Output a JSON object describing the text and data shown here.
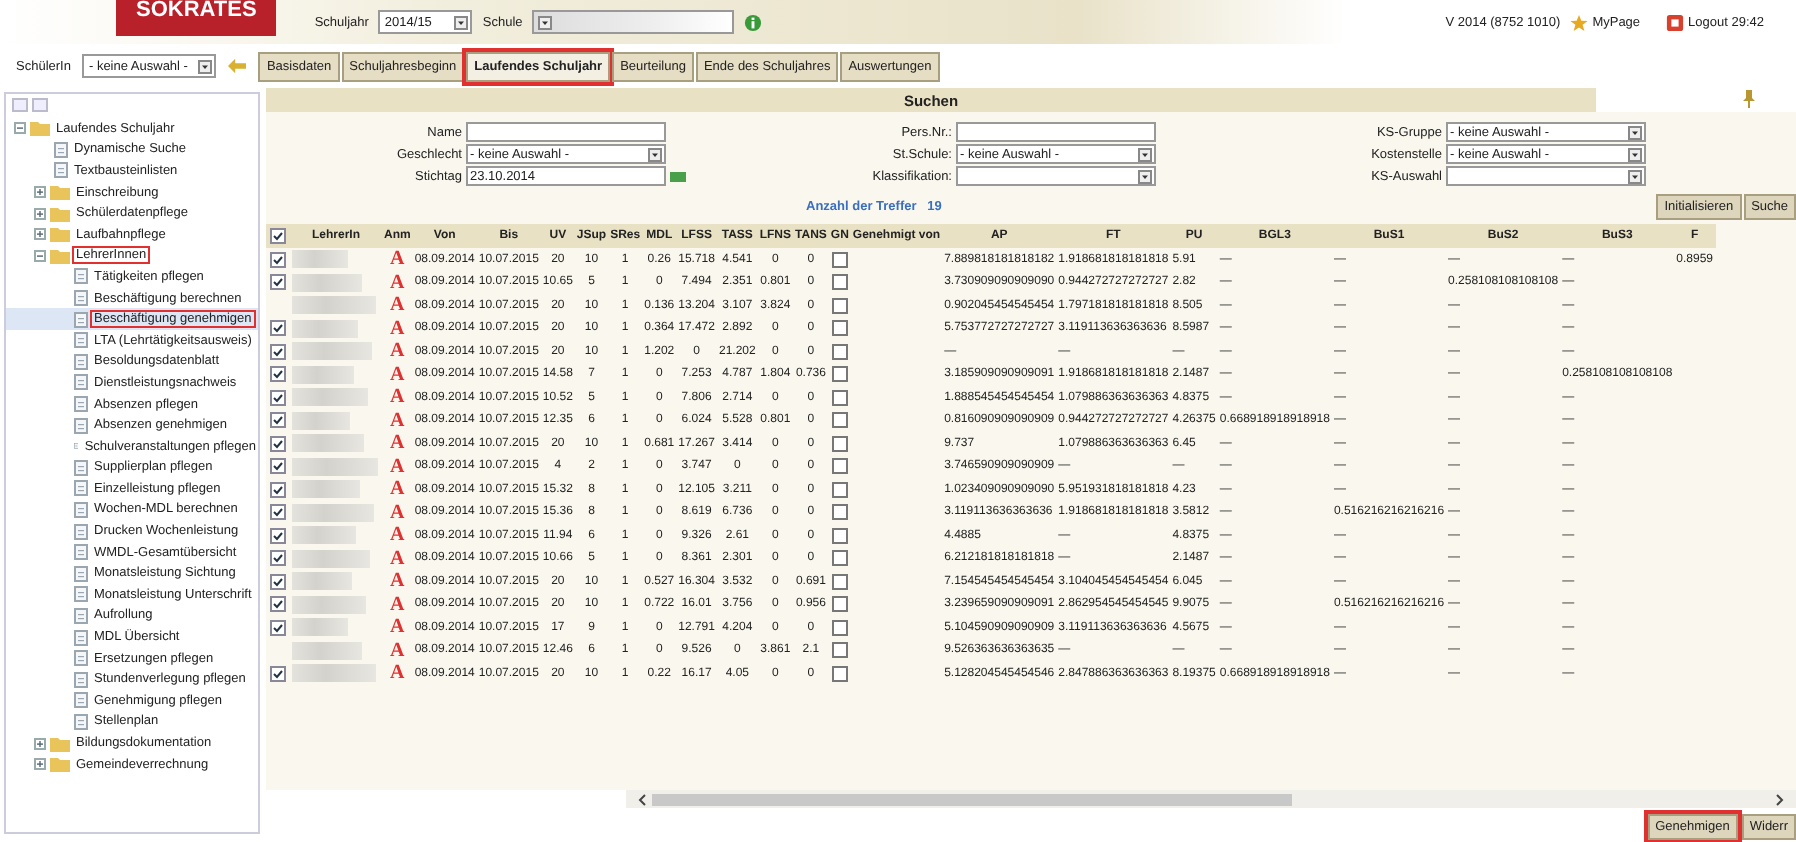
{
  "header": {
    "logo": "SOKRATES",
    "schuljahr_label": "Schuljahr",
    "schuljahr": "2014/15",
    "schule_label": "Schule",
    "version": "V 2014 (8752 1010)",
    "mypage": "MyPage",
    "logout": "Logout 29:42"
  },
  "student_filter": {
    "label": "SchülerIn",
    "value": "- keine Auswahl -"
  },
  "tabs": [
    {
      "label": "Basisdaten",
      "selected": false,
      "marked": false
    },
    {
      "label": "Schuljahresbeginn",
      "selected": false,
      "marked": false
    },
    {
      "label": "Laufendes Schuljahr",
      "selected": true,
      "marked": true
    },
    {
      "label": "Beurteilung",
      "selected": false,
      "marked": false
    },
    {
      "label": "Ende des Schuljahres",
      "selected": false,
      "marked": false
    },
    {
      "label": "Auswertungen",
      "selected": false,
      "marked": false
    }
  ],
  "sidebar": {
    "tree": [
      {
        "label": "Laufendes Schuljahr",
        "kind": "folder",
        "expanded": true,
        "selected": false,
        "marked": false,
        "children": [
          {
            "label": "Dynamische Suche",
            "kind": "page",
            "selected": false,
            "marked": false
          },
          {
            "label": "Textbausteinlisten",
            "kind": "page",
            "selected": false,
            "marked": false
          },
          {
            "label": "Einschreibung",
            "kind": "folder",
            "expanded": false,
            "selected": false,
            "marked": false
          },
          {
            "label": "Schülerdatenpflege",
            "kind": "folder",
            "expanded": false,
            "selected": false,
            "marked": false
          },
          {
            "label": "Laufbahnpflege",
            "kind": "folder",
            "expanded": false,
            "selected": false,
            "marked": false
          },
          {
            "label": "LehrerInnen",
            "kind": "folder",
            "expanded": true,
            "selected": false,
            "marked": true,
            "children": [
              {
                "label": "Tätigkeiten pflegen",
                "kind": "page",
                "selected": false,
                "marked": false
              },
              {
                "label": "Beschäftigung berechnen",
                "kind": "page",
                "selected": false,
                "marked": false
              },
              {
                "label": "Beschäftigung genehmigen",
                "kind": "page",
                "selected": true,
                "marked": true
              },
              {
                "label": "LTA (Lehrtätigkeitsausweis)",
                "kind": "page",
                "selected": false,
                "marked": false
              },
              {
                "label": "Besoldungsdatenblatt",
                "kind": "page",
                "selected": false,
                "marked": false
              },
              {
                "label": "Dienstleistungsnachweis",
                "kind": "page",
                "selected": false,
                "marked": false
              },
              {
                "label": "Absenzen pflegen",
                "kind": "page",
                "selected": false,
                "marked": false
              },
              {
                "label": "Absenzen genehmigen",
                "kind": "page",
                "selected": false,
                "marked": false
              },
              {
                "label": "Schulveranstaltungen pflegen",
                "kind": "page",
                "selected": false,
                "marked": false
              },
              {
                "label": "Supplierplan pflegen",
                "kind": "page",
                "selected": false,
                "marked": false
              },
              {
                "label": "Einzelleistung pflegen",
                "kind": "page",
                "selected": false,
                "marked": false
              },
              {
                "label": "Wochen-MDL berechnen",
                "kind": "page",
                "selected": false,
                "marked": false
              },
              {
                "label": "Drucken Wochenleistung",
                "kind": "page",
                "selected": false,
                "marked": false
              },
              {
                "label": "WMDL-Gesamtübersicht",
                "kind": "page",
                "selected": false,
                "marked": false
              },
              {
                "label": "Monatsleistung Sichtung",
                "kind": "page",
                "selected": false,
                "marked": false
              },
              {
                "label": "Monatsleistung Unterschrift",
                "kind": "page",
                "selected": false,
                "marked": false
              },
              {
                "label": "Aufrollung",
                "kind": "page",
                "selected": false,
                "marked": false
              },
              {
                "label": "MDL Übersicht",
                "kind": "page",
                "selected": false,
                "marked": false
              },
              {
                "label": "Ersetzungen pflegen",
                "kind": "page",
                "selected": false,
                "marked": false
              },
              {
                "label": "Stundenverlegung pflegen",
                "kind": "page",
                "selected": false,
                "marked": false
              },
              {
                "label": "Genehmigung pflegen",
                "kind": "page",
                "selected": false,
                "marked": false
              },
              {
                "label": "Stellenplan",
                "kind": "page",
                "selected": false,
                "marked": false
              }
            ]
          },
          {
            "label": "Bildungsdokumentation",
            "kind": "folder",
            "expanded": false,
            "selected": false,
            "marked": false
          },
          {
            "label": "Gemeindeverrechnung",
            "kind": "folder",
            "expanded": false,
            "selected": false,
            "marked": false
          }
        ]
      }
    ]
  },
  "search": {
    "title": "Suchen",
    "fields": [
      [
        {
          "label": "Name",
          "kind": "text"
        },
        {
          "label": "Geschlecht",
          "kind": "select",
          "value": "- keine Auswahl -"
        },
        {
          "label": "Stichtag",
          "kind": "date",
          "value": "23.10.2014"
        }
      ],
      [
        {
          "label": "Pers.Nr.:",
          "kind": "text"
        },
        {
          "label": "St.Schule:",
          "kind": "select",
          "value": "- keine Auswahl -"
        },
        {
          "label": "Klassifikation:",
          "kind": "select"
        }
      ],
      [
        {
          "label": "KS-Gruppe",
          "kind": "select",
          "value": "- keine Auswahl -"
        },
        {
          "label": "Kostenstelle",
          "kind": "select",
          "value": "- keine Auswahl -"
        },
        {
          "label": "KS-Auswahl",
          "kind": "select"
        }
      ]
    ],
    "hits_label": "Anzahl der Treffer",
    "hits": "19",
    "buttons": [
      "Initialisieren",
      "Suche"
    ]
  },
  "table": {
    "select_all": true,
    "columns": [
      "LehrerIn",
      "Anm",
      "Von",
      "Bis",
      "UV",
      "JSup",
      "SRes",
      "MDL",
      "LFSS",
      "TASS",
      "LFNS",
      "TANS",
      "GN",
      "Genehmigt von",
      "AP",
      "FT",
      "PU",
      "BGL3",
      "BuS1",
      "BuS2",
      "BuS3",
      "F"
    ],
    "rows": [
      {
        "has_checkbox": true,
        "checked": true,
        "anm": "A",
        "values": [
          "08.09.2014",
          "10.07.2015",
          "20",
          "10",
          "1",
          "0.26",
          "15.718",
          "4.541",
          "0",
          "0"
        ],
        "gn": false,
        "results": [
          "7.889818181818182",
          "1.918681818181818",
          "5.91",
          "—",
          "—",
          "—",
          "—",
          "0.8959"
        ]
      },
      {
        "has_checkbox": true,
        "checked": true,
        "anm": "A",
        "values": [
          "08.09.2014",
          "10.07.2015",
          "10.65",
          "5",
          "1",
          "0",
          "7.494",
          "2.351",
          "0.801",
          "0"
        ],
        "gn": false,
        "results": [
          "3.730909090909090",
          "0.944272727272727",
          "2.82",
          "—",
          "—",
          "0.258108108108108",
          "—"
        ]
      },
      {
        "has_checkbox": false,
        "checked": false,
        "anm": "A",
        "values": [
          "08.09.2014",
          "10.07.2015",
          "20",
          "10",
          "1",
          "0.136",
          "13.204",
          "3.107",
          "3.824",
          "0"
        ],
        "gn": false,
        "results": [
          "0.902045454545454",
          "1.797181818181818",
          "8.505",
          "—",
          "—",
          "—",
          "—"
        ]
      },
      {
        "has_checkbox": true,
        "checked": true,
        "anm": "A",
        "values": [
          "08.09.2014",
          "10.07.2015",
          "20",
          "10",
          "1",
          "0.364",
          "17.472",
          "2.892",
          "0",
          "0"
        ],
        "gn": false,
        "results": [
          "5.753772727272727",
          "3.119113636363636",
          "8.5987",
          "—",
          "—",
          "—",
          "—"
        ]
      },
      {
        "has_checkbox": true,
        "checked": true,
        "anm": "A",
        "values": [
          "08.09.2014",
          "10.07.2015",
          "20",
          "10",
          "1",
          "1.202",
          "0",
          "21.202",
          "0",
          "0"
        ],
        "gn": false,
        "results": [
          "—",
          "—",
          "—",
          "—",
          "—",
          "—",
          "—"
        ]
      },
      {
        "has_checkbox": true,
        "checked": true,
        "anm": "A",
        "values": [
          "08.09.2014",
          "10.07.2015",
          "14.58",
          "7",
          "1",
          "0",
          "7.253",
          "4.787",
          "1.804",
          "0.736"
        ],
        "gn": false,
        "results": [
          "3.185909090909091",
          "1.918681818181818",
          "2.1487",
          "—",
          "—",
          "—",
          "0.258108108108108"
        ]
      },
      {
        "has_checkbox": true,
        "checked": true,
        "anm": "A",
        "values": [
          "08.09.2014",
          "10.07.2015",
          "10.52",
          "5",
          "1",
          "0",
          "7.806",
          "2.714",
          "0",
          "0"
        ],
        "gn": false,
        "results": [
          "1.888545454545454",
          "1.079886363636363",
          "4.8375",
          "—",
          "—",
          "—",
          "—"
        ]
      },
      {
        "has_checkbox": true,
        "checked": true,
        "anm": "A",
        "values": [
          "08.09.2014",
          "10.07.2015",
          "12.35",
          "6",
          "1",
          "0",
          "6.024",
          "5.528",
          "0.801",
          "0"
        ],
        "gn": false,
        "results": [
          "0.816090909090909",
          "0.944272727272727",
          "4.26375",
          "0.668918918918918",
          "—",
          "—",
          "—"
        ]
      },
      {
        "has_checkbox": true,
        "checked": true,
        "anm": "A",
        "values": [
          "08.09.2014",
          "10.07.2015",
          "20",
          "10",
          "1",
          "0.681",
          "17.267",
          "3.414",
          "0",
          "0"
        ],
        "gn": false,
        "results": [
          "9.737",
          "1.079886363636363",
          "6.45",
          "—",
          "—",
          "—",
          "—"
        ]
      },
      {
        "has_checkbox": true,
        "checked": true,
        "anm": "A",
        "values": [
          "08.09.2014",
          "10.07.2015",
          "4",
          "2",
          "1",
          "0",
          "3.747",
          "0",
          "0",
          "0"
        ],
        "gn": false,
        "results": [
          "3.746590909090909",
          "—",
          "—",
          "—",
          "—",
          "—",
          "—"
        ]
      },
      {
        "has_checkbox": true,
        "checked": true,
        "anm": "A",
        "values": [
          "08.09.2014",
          "10.07.2015",
          "15.32",
          "8",
          "1",
          "0",
          "12.105",
          "3.211",
          "0",
          "0"
        ],
        "gn": false,
        "results": [
          "1.023409090909090",
          "5.951931818181818",
          "4.23",
          "—",
          "—",
          "—",
          "—"
        ]
      },
      {
        "has_checkbox": true,
        "checked": true,
        "anm": "A",
        "values": [
          "08.09.2014",
          "10.07.2015",
          "15.36",
          "8",
          "1",
          "0",
          "8.619",
          "6.736",
          "0",
          "0"
        ],
        "gn": false,
        "results": [
          "3.119113636363636",
          "1.918681818181818",
          "3.5812",
          "—",
          "0.516216216216216",
          "—",
          "—"
        ]
      },
      {
        "has_checkbox": true,
        "checked": true,
        "anm": "A",
        "values": [
          "08.09.2014",
          "10.07.2015",
          "11.94",
          "6",
          "1",
          "0",
          "9.326",
          "2.61",
          "0",
          "0"
        ],
        "gn": false,
        "results": [
          "4.4885",
          "—",
          "4.8375",
          "—",
          "—",
          "—",
          "—"
        ]
      },
      {
        "has_checkbox": true,
        "checked": true,
        "anm": "A",
        "values": [
          "08.09.2014",
          "10.07.2015",
          "10.66",
          "5",
          "1",
          "0",
          "8.361",
          "2.301",
          "0",
          "0"
        ],
        "gn": false,
        "results": [
          "6.212181818181818",
          "—",
          "2.1487",
          "—",
          "—",
          "—",
          "—"
        ]
      },
      {
        "has_checkbox": true,
        "checked": true,
        "anm": "A",
        "values": [
          "08.09.2014",
          "10.07.2015",
          "20",
          "10",
          "1",
          "0.527",
          "16.304",
          "3.532",
          "0",
          "0.691"
        ],
        "gn": false,
        "results": [
          "7.154545454545454",
          "3.104045454545454",
          "6.045",
          "—",
          "—",
          "—",
          "—"
        ]
      },
      {
        "has_checkbox": true,
        "checked": true,
        "anm": "A",
        "values": [
          "08.09.2014",
          "10.07.2015",
          "20",
          "10",
          "1",
          "0.722",
          "16.01",
          "3.756",
          "0",
          "0.956"
        ],
        "gn": false,
        "results": [
          "3.239659090909091",
          "2.862954545454545",
          "9.9075",
          "—",
          "0.516216216216216",
          "—",
          "—"
        ]
      },
      {
        "has_checkbox": true,
        "checked": true,
        "anm": "A",
        "values": [
          "08.09.2014",
          "10.07.2015",
          "17",
          "9",
          "1",
          "0",
          "12.791",
          "4.204",
          "0",
          "0"
        ],
        "gn": false,
        "results": [
          "5.104590909090909",
          "3.119113636363636",
          "4.5675",
          "—",
          "—",
          "—",
          "—"
        ]
      },
      {
        "has_checkbox": false,
        "checked": false,
        "anm": "A",
        "values": [
          "08.09.2014",
          "10.07.2015",
          "12.46",
          "6",
          "1",
          "0",
          "9.526",
          "0",
          "3.861",
          "2.1"
        ],
        "gn": false,
        "results": [
          "9.526363636363635",
          "—",
          "—",
          "—",
          "—",
          "—",
          "—"
        ]
      },
      {
        "has_checkbox": true,
        "checked": true,
        "anm": "A",
        "values": [
          "08.09.2014",
          "10.07.2015",
          "20",
          "10",
          "1",
          "0.22",
          "16.17",
          "4.05",
          "0",
          "0"
        ],
        "gn": false,
        "results": [
          "5.128204545454546",
          "2.847886363636363",
          "8.19375",
          "0.668918918918918",
          "—",
          "—",
          "—"
        ]
      }
    ]
  },
  "footer_buttons": [
    {
      "label": "Genehmigen",
      "marked": true
    },
    {
      "label": "Widerr",
      "marked": false
    }
  ]
}
